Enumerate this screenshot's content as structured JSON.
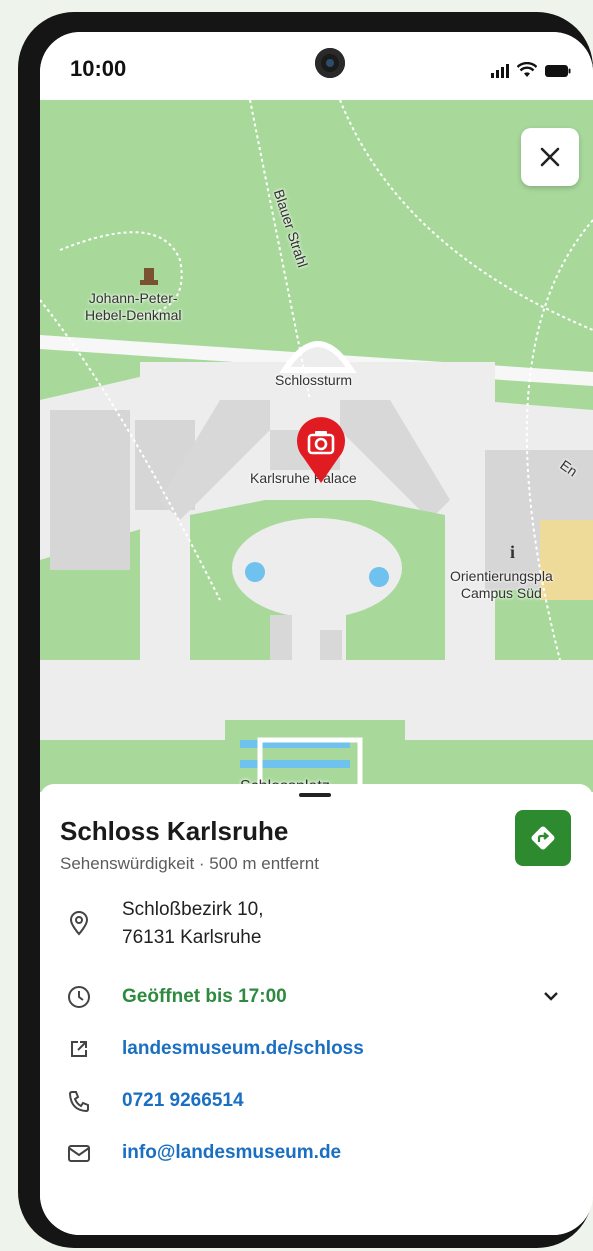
{
  "status_bar": {
    "time": "10:00"
  },
  "map": {
    "labels": {
      "street": "Blauer Strahl",
      "monument": "Johann-Peter-\nHebel-Denkmal",
      "tower": "Schlossturm",
      "palace": "Karlsruhe Palace",
      "info": "Orientierungspla\nCampus Süd",
      "road_fragment": "En",
      "square_fragment": "Schlossplatz"
    },
    "colors": {
      "grass": "#a8d99b",
      "paving": "#eeeeee",
      "water": "#6fc1ee",
      "building": "#d8d8d8",
      "pin": "#e11b22"
    }
  },
  "place": {
    "name": "Schloss Karlsruhe",
    "subtitle": "Sehenswürdigkeit · 500 m entfernt",
    "address_line1": "Schloßbezirk 10,",
    "address_line2": "76131 Karlsruhe",
    "hours": "Geöffnet bis 17:00",
    "website": "landesmuseum.de/schloss",
    "phone": "0721 9266514",
    "email": "info@landesmuseum.de"
  },
  "colors": {
    "accent_green": "#2e8a2f",
    "link_blue": "#1a6fc2"
  },
  "icons": {
    "close": "close-icon",
    "directions": "directions-icon",
    "location": "location-pin-icon",
    "clock": "clock-icon",
    "external_link": "external-link-icon",
    "phone": "phone-icon",
    "mail": "mail-icon",
    "expand": "chevron-down-icon",
    "camera_pin": "camera-pin-icon"
  }
}
